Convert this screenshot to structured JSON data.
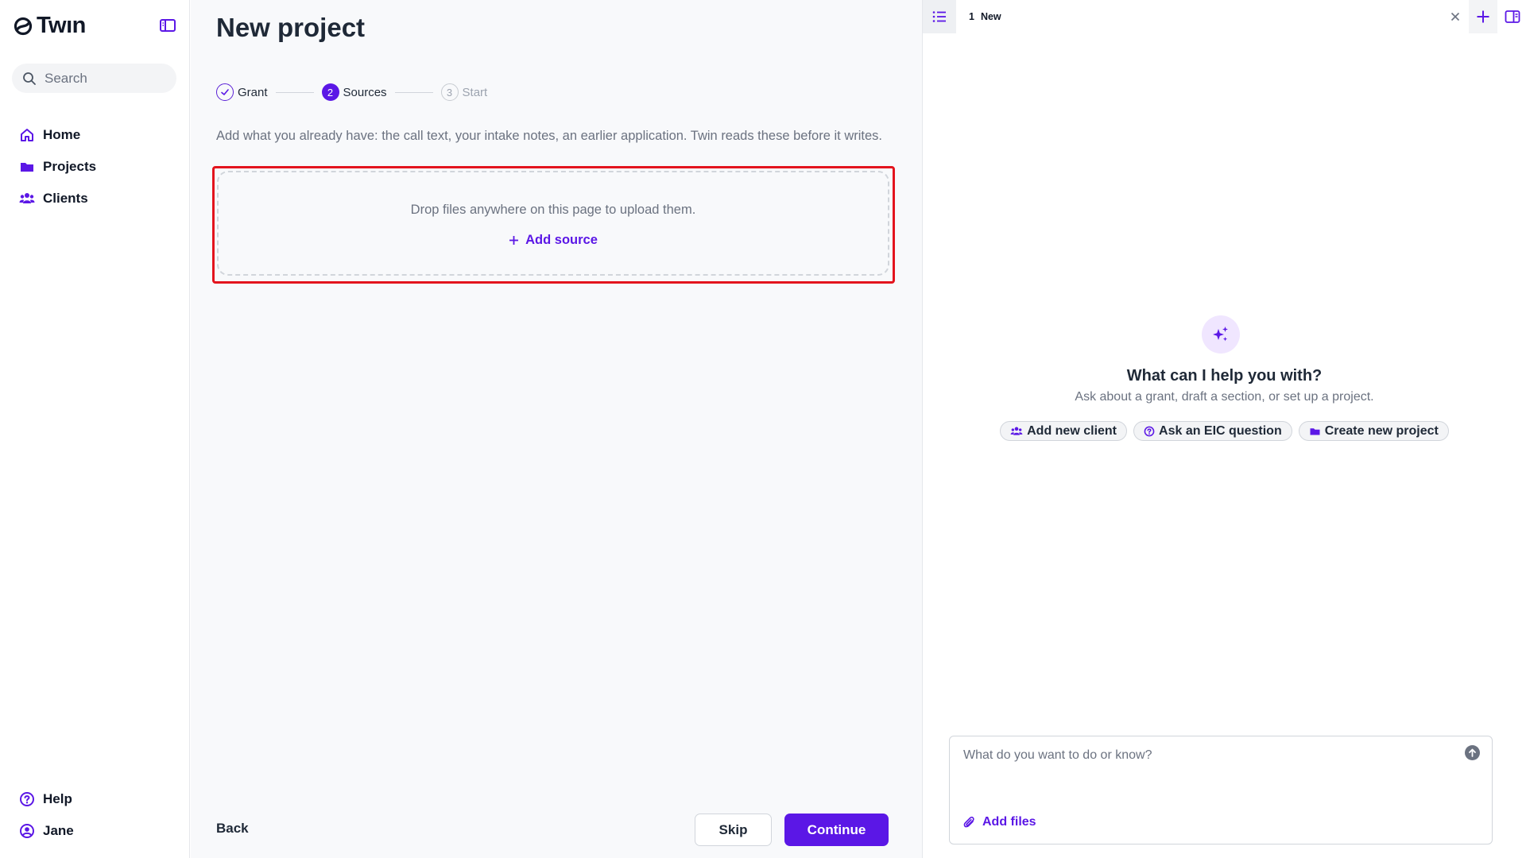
{
  "sidebar": {
    "logo_text": "Twın",
    "search_placeholder": "Search",
    "nav": [
      {
        "label": "Home",
        "icon": "home-icon"
      },
      {
        "label": "Projects",
        "icon": "folder-icon"
      },
      {
        "label": "Clients",
        "icon": "users-icon"
      }
    ],
    "bottom": [
      {
        "label": "Help",
        "icon": "help-circle-icon"
      },
      {
        "label": "Jane",
        "icon": "user-circle-icon"
      }
    ]
  },
  "main": {
    "title": "New project",
    "steps": [
      {
        "number": "",
        "label": "Grant",
        "state": "done"
      },
      {
        "number": "2",
        "label": "Sources",
        "state": "active"
      },
      {
        "number": "3",
        "label": "Start",
        "state": "todo"
      }
    ],
    "intro": "Add what you already have: the call text, your intake notes, an earlier application. Twin reads these before it writes.",
    "dropzone": {
      "text": "Drop files anywhere on this page to upload them.",
      "add_label": "Add source"
    },
    "back_label": "Back",
    "skip_label": "Skip",
    "continue_label": "Continue"
  },
  "chat": {
    "tab": {
      "number": "1",
      "title": "New"
    },
    "heading": "What can I help you with?",
    "subheading": "Ask about a grant, draft a section, or set up a project.",
    "chips": [
      {
        "label": "Add new client",
        "icon": "users-icon"
      },
      {
        "label": "Ask an EIC question",
        "icon": "help-circle-icon"
      },
      {
        "label": "Create new project",
        "icon": "folder-icon"
      }
    ],
    "composer_placeholder": "What do you want to do or know?",
    "add_files_label": "Add files"
  },
  "colors": {
    "accent": "#5b17e6",
    "highlight_border": "#e3141d",
    "muted_text": "#6b7280",
    "main_bg": "#f8f9fb"
  }
}
